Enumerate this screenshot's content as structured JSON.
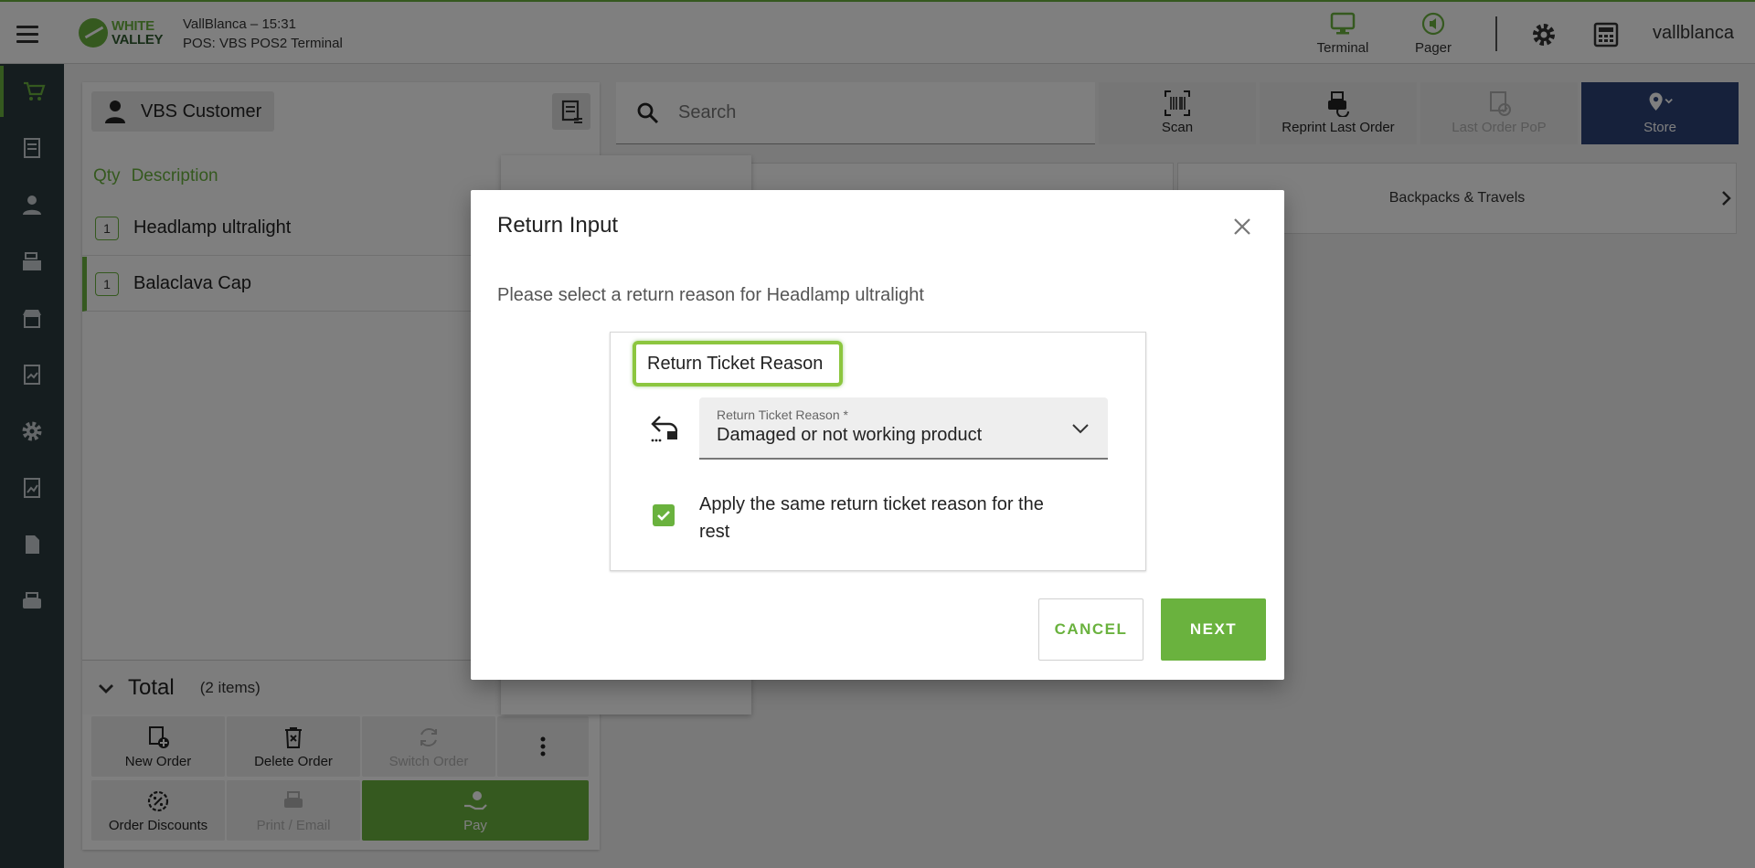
{
  "header": {
    "logo_line1": "WHITE",
    "logo_line2": "VALLEY",
    "store_line1": "VallBlanca – 15:31",
    "store_line2": "POS: VBS POS2 Terminal",
    "terminal_label": "Terminal",
    "pager_label": "Pager",
    "username": "vallblanca"
  },
  "nav": {
    "icons": [
      "cart-icon",
      "receipt-icon",
      "person-icon",
      "cash-register-icon",
      "store-icon",
      "report-icon",
      "settings-icon",
      "chart-icon",
      "document-icon",
      "printer-icon"
    ]
  },
  "ticket": {
    "customer_name": "VBS Customer",
    "col_qty": "Qty",
    "col_description": "Description",
    "lines": [
      {
        "qty": "1",
        "description": "Headlamp ultralight"
      },
      {
        "qty": "1",
        "description": "Balaclava Cap"
      }
    ],
    "total_label": "Total",
    "item_count": "(2 items)",
    "actions": {
      "new_order": "New Order",
      "delete_order": "Delete Order",
      "switch_order": "Switch Order",
      "order_discounts": "Order Discounts",
      "print_email": "Print / Email",
      "pay": "Pay"
    }
  },
  "toolbar": {
    "search_placeholder": "Search",
    "scan": "Scan",
    "reprint": "Reprint Last Order",
    "last_pop": "Last Order PoP",
    "store": "Store"
  },
  "categories": [
    "Backpacks & Travels"
  ],
  "dialog": {
    "title": "Return Input",
    "message": "Please select a return reason for Headlamp ultralight",
    "section_label": "Return Ticket Reason",
    "select_label": "Return Ticket Reason *",
    "select_value": "Damaged or not working product",
    "apply_same_label": "Apply the same return ticket reason for the rest",
    "apply_same_checked": true,
    "cancel_label": "CANCEL",
    "next_label": "NEXT"
  },
  "colors": {
    "accent": "#6ab23e",
    "nav_bg": "#2b3a3f",
    "store_button": "#2d4376"
  }
}
